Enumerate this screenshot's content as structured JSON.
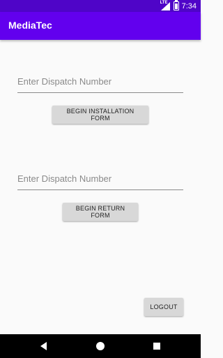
{
  "status_bar": {
    "network_label": "LTE",
    "time": "7:34"
  },
  "app_bar": {
    "title": "MediaTec"
  },
  "installation": {
    "dispatch_placeholder": "Enter Dispatch Number",
    "dispatch_value": "",
    "button_label": "BEGIN INSTALLATION FORM"
  },
  "return": {
    "dispatch_placeholder": "Enter Dispatch Number",
    "dispatch_value": "",
    "button_label": "BEGIN RETURN FORM"
  },
  "logout": {
    "button_label": "LOGOUT"
  },
  "colors": {
    "status_bar": "#4f05c8",
    "app_bar": "#6200ee",
    "button": "#d8d8d8",
    "background": "#fafafa"
  },
  "icons": [
    "signal-icon",
    "battery-icon",
    "back-icon",
    "home-icon",
    "recents-icon"
  ]
}
